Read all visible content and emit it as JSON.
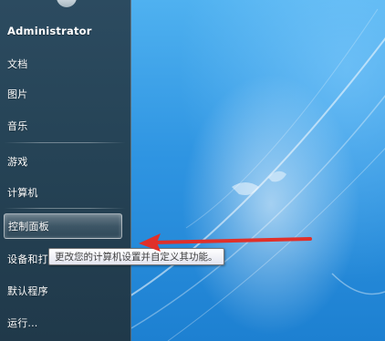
{
  "start_menu": {
    "user_name": "Administrator",
    "items": [
      {
        "label": "文档"
      },
      {
        "label": "图片"
      },
      {
        "label": "音乐"
      },
      {
        "label": "游戏"
      },
      {
        "label": "计算机"
      },
      {
        "label": "控制面板"
      },
      {
        "label": "设备和打"
      },
      {
        "label": "默认程序"
      },
      {
        "label": "运行..."
      }
    ],
    "highlighted": "控制面板"
  },
  "tooltip": {
    "text": "更改您的计算机设置并自定义其功能。"
  },
  "annotation": {
    "arrow_color": "#e0302a"
  }
}
